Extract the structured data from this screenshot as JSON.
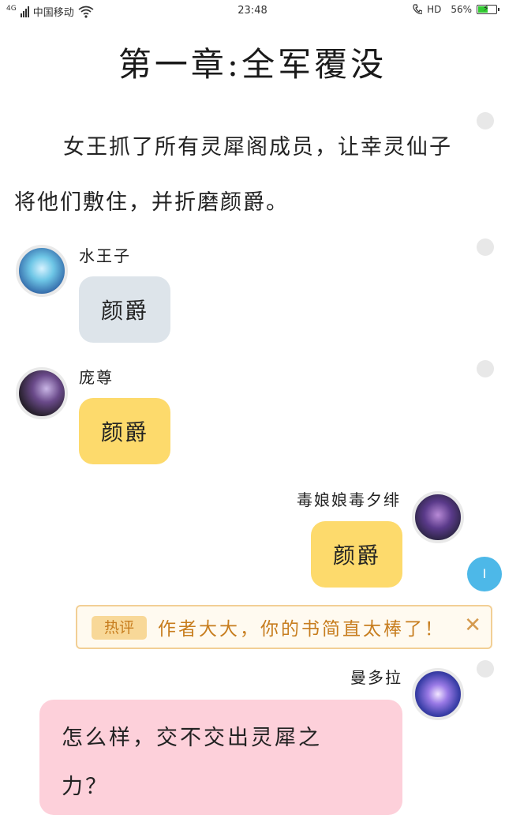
{
  "status_bar": {
    "network": "4G",
    "carrier": "中国移动",
    "time": "23:48",
    "hd": "HD",
    "battery": "56%",
    "battery_level": 0.56
  },
  "chapter_title": "第一章:全军覆没",
  "narration": "女王抓了所有灵犀阁成员，让幸灵仙子将他们敷住，并折磨颜爵。",
  "messages": [
    {
      "name": "水王子",
      "text": "颜爵",
      "side": "left",
      "bubble_color": "#dde4ea"
    },
    {
      "name": "庞尊",
      "text": "颜爵",
      "side": "left",
      "bubble_color": "#fdda6c"
    },
    {
      "name": "毒娘娘毒夕绯",
      "text": "颜爵",
      "side": "right",
      "bubble_color": "#fdda6c"
    },
    {
      "name": "曼多拉",
      "text": "怎么样，交不交出灵犀之力？",
      "side": "right",
      "bubble_color": "#fdd0da"
    }
  ],
  "hot_comment": {
    "tag": "热评",
    "text": "作者大大，你的书简直太棒了！",
    "close_icon": "close-icon"
  },
  "float_button": {
    "label": "I"
  },
  "colors": {
    "accent_blue": "#4db8e8",
    "comment_orange": "#c77d1e"
  }
}
